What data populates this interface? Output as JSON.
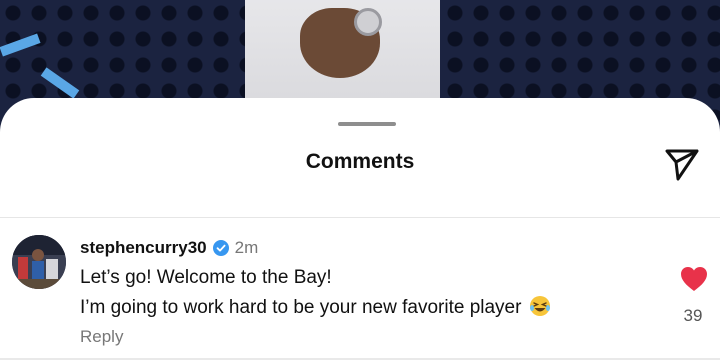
{
  "sheet": {
    "title": "Comments"
  },
  "comment": {
    "username": "stephencurry30",
    "time": "2m",
    "line1": "Let’s go! Welcome to the Bay!",
    "line2": "I’m going to work hard to be your new favorite player",
    "reply_label": "Reply",
    "like_count": "39",
    "liked": true
  },
  "icons": {
    "share": "send-icon",
    "verified": "verified-badge-icon",
    "like": "heart-filled-icon",
    "emoji": "laughing-emoji"
  },
  "colors": {
    "like": "#e8324a",
    "verified": "#3797f0",
    "muted_text": "#777777"
  }
}
